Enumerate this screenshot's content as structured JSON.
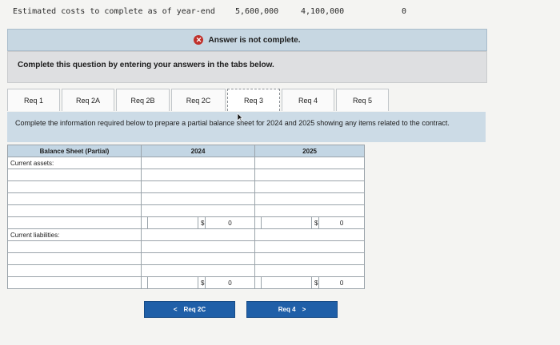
{
  "cost_row": {
    "label": "Estimated costs to complete as of year-end",
    "value_1": "5,600,000",
    "value_2": "4,100,000",
    "value_3": "0"
  },
  "banner": {
    "icon": "x-circle-icon",
    "text": "Answer is not complete."
  },
  "instruction": "Complete this question by entering your answers in the tabs below.",
  "tabs": [
    {
      "label": "Req 1",
      "active": false
    },
    {
      "label": "Req 2A",
      "active": false
    },
    {
      "label": "Req 2B",
      "active": false
    },
    {
      "label": "Req 2C",
      "active": false
    },
    {
      "label": "Req 3",
      "active": true
    },
    {
      "label": "Req 4",
      "active": false
    },
    {
      "label": "Req 5",
      "active": false
    }
  ],
  "requirement_text": "Complete the information required below to prepare a partial balance sheet for 2024 and 2025 showing any items related to the contract.",
  "table": {
    "header": [
      "Balance Sheet (Partial)",
      "2024",
      "2025"
    ],
    "current_assets_label": "Current assets:",
    "current_liabilities_label": "Current liabilities:",
    "assets_total": {
      "sym_2024": "$",
      "val_2024": "0",
      "sym_2025": "$",
      "val_2025": "0"
    },
    "liabilities_total": {
      "sym_2024": "$",
      "val_2024": "0",
      "sym_2025": "$",
      "val_2025": "0"
    }
  },
  "nav": {
    "prev_label": "Req 2C",
    "prev_arrow": "<",
    "next_label": "Req 4",
    "next_arrow": ">"
  }
}
